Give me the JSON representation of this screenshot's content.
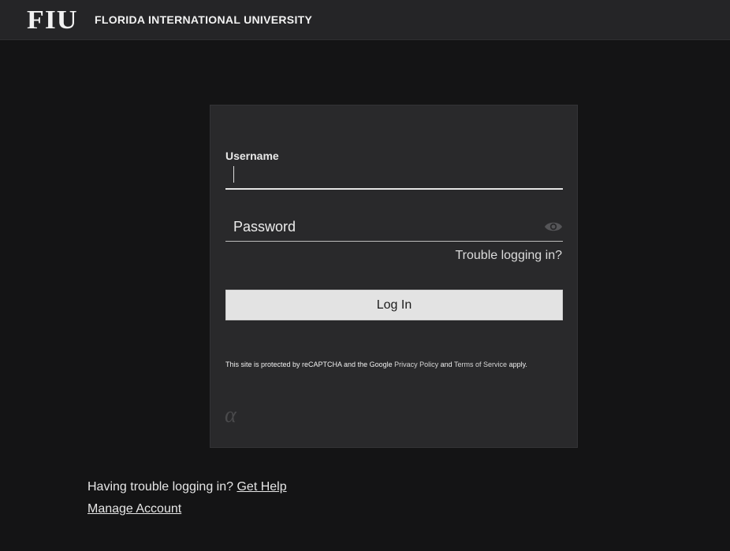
{
  "header": {
    "logo_text": "FIU",
    "university_name": "FLORIDA INTERNATIONAL UNIVERSITY"
  },
  "login_form": {
    "username_label": "Username",
    "username_value": "",
    "password_placeholder": "Password",
    "password_value": "",
    "show_password_icon": "eye-icon",
    "trouble_link": "Trouble logging in?",
    "login_button": "Log In",
    "recaptcha_prefix": "This site is protected by reCAPTCHA and the Google",
    "privacy_policy_link": "Privacy Policy",
    "recaptcha_and": "and",
    "terms_link": "Terms of Service",
    "recaptcha_suffix": "apply.",
    "footer_mark": "α"
  },
  "footer": {
    "help_text": "Having trouble logging in?",
    "get_help_link": "Get Help",
    "manage_account_link": "Manage Account"
  },
  "colors": {
    "page_background": "#141415",
    "header_background": "#252527",
    "card_background": "#29292b",
    "button_background": "#e3e3e3",
    "text_primary": "#e8e8e8"
  }
}
